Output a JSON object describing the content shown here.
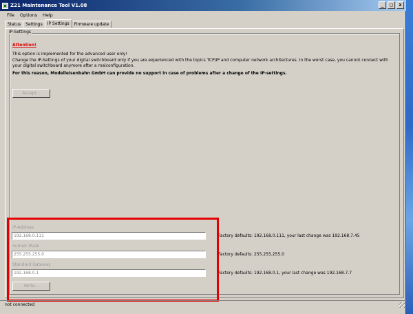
{
  "window": {
    "title": "Z21 Maintenance Tool V1.08",
    "minimize": "_",
    "maximize": "□",
    "close": "x"
  },
  "menu": [
    "File",
    "Options",
    "Help"
  ],
  "tabs": [
    "Status",
    "Settings",
    "IP Settings",
    "Firmware update"
  ],
  "active_tab": "IP Settings",
  "group": {
    "title": "IP-Settings",
    "attention": "Attention!",
    "line1": "This option is implemented for the advanced user only!",
    "line2": "Change the IP-Settings of your digital switchboard only if you are experienced with the topics TCP/IP and computer network architectures. In the worst case, you cannot connect with your digital switchboard anymore after a malconfiguration.",
    "line3": "For this reason, Modelleisenbahn GmbH can provide no support in case of problems after a change of the IP-settings.",
    "accept_label": "Accept..."
  },
  "fields": {
    "ip_label": "IP-Address",
    "ip_value": "192.168.0.111",
    "ip_factory": "Factory defaults: 192.168.0.111, your last change was 192.168.7.45",
    "subnet_label": "Subnet-Mask",
    "subnet_value": "255.255.255.0",
    "subnet_factory": "Factory defaults: 255.255.255.0",
    "gateway_label": "Standard Gateway",
    "gateway_value": "192.168.0.1",
    "gateway_factory": "Factory defaults: 192.168.0.1, your last change was 192.168.7.7",
    "write_label": "Write..."
  },
  "status": "not connected",
  "colors": {
    "highlight_box": "#e40000",
    "attention": "#e00000"
  }
}
